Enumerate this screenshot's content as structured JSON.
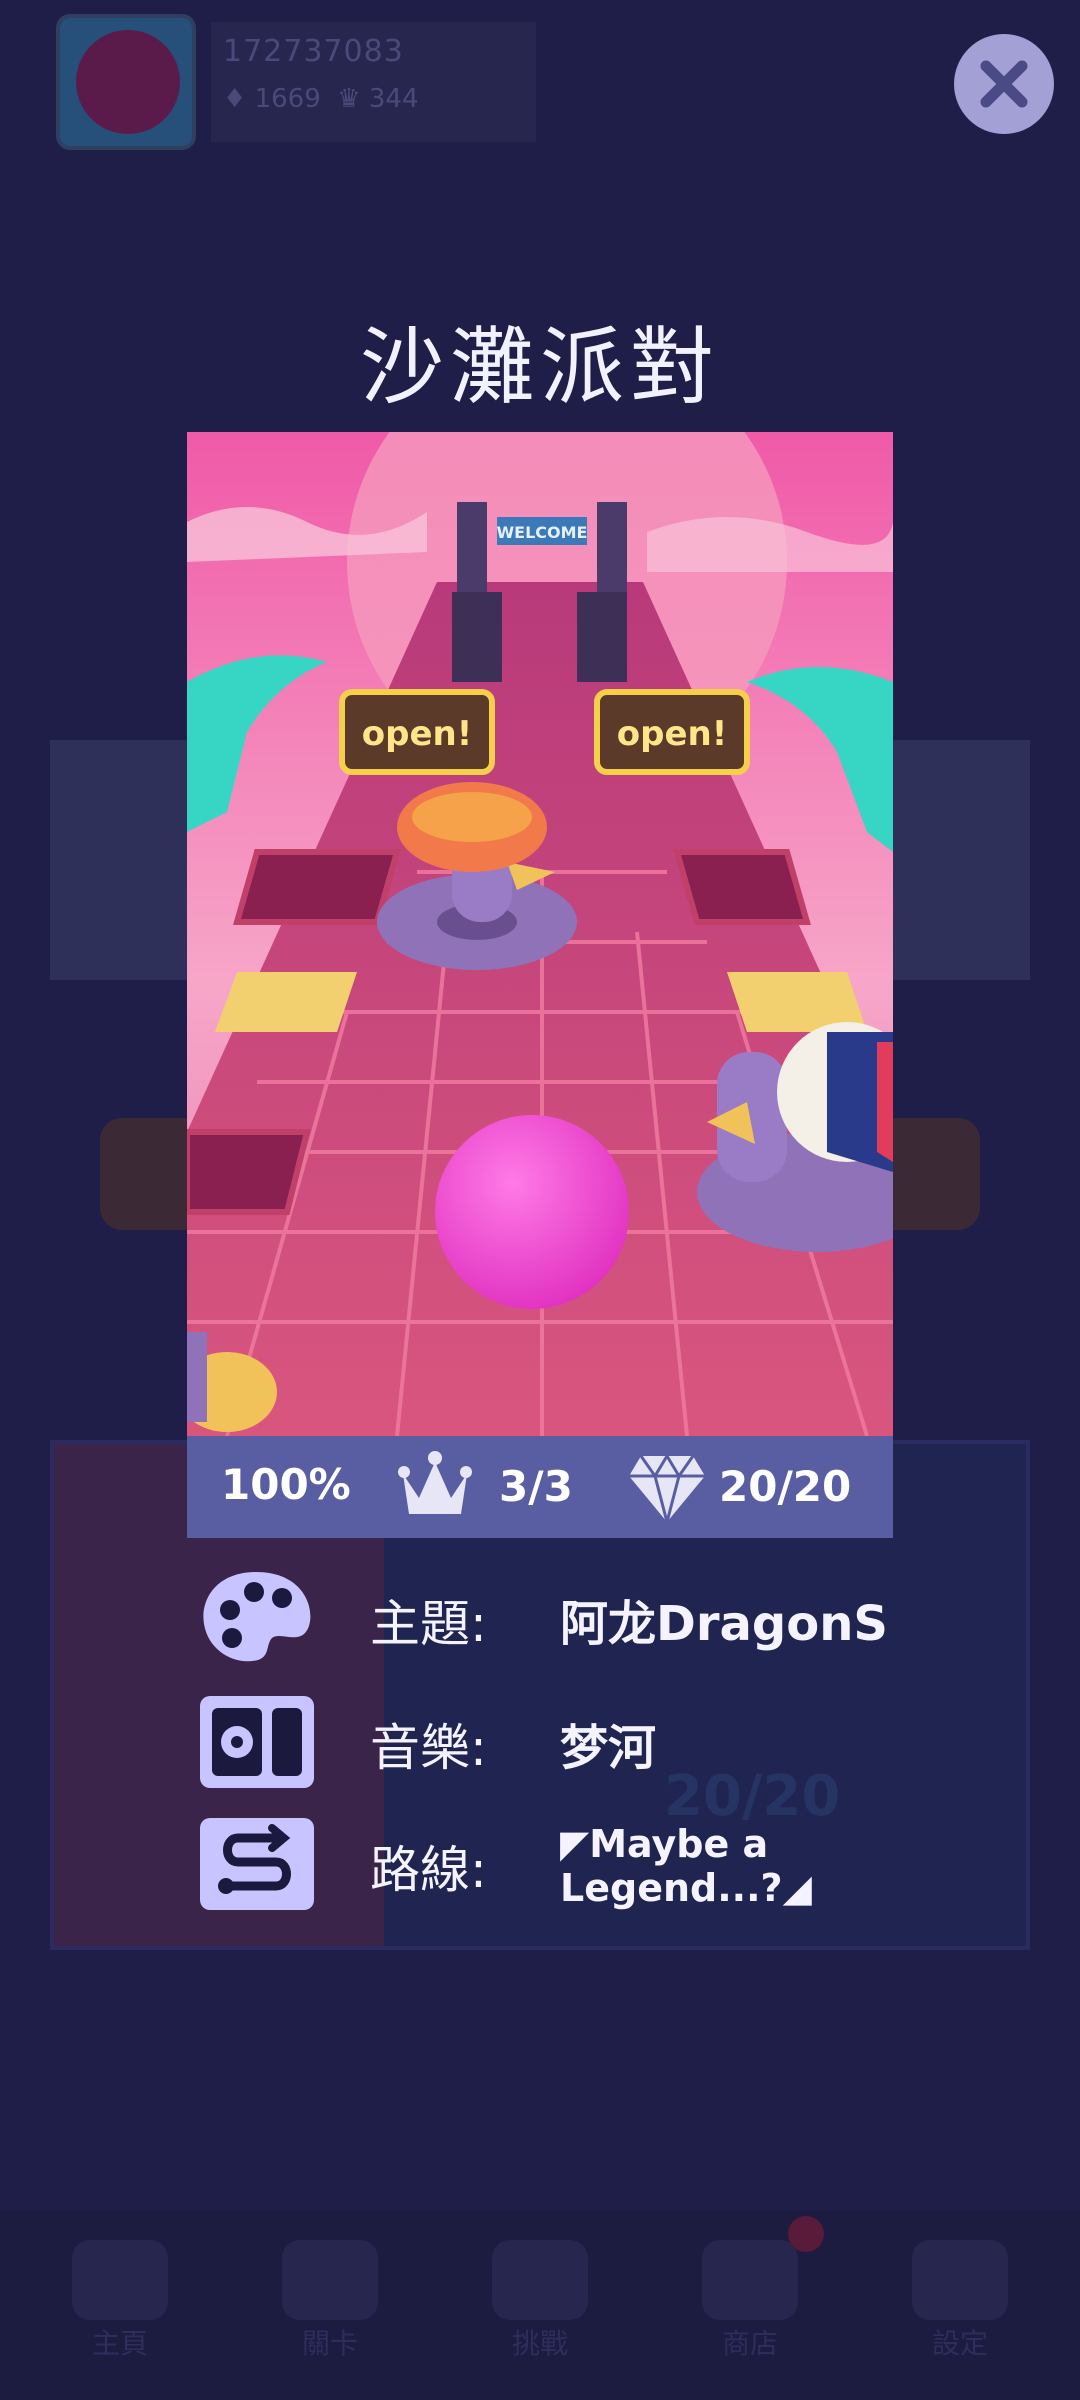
{
  "background": {
    "player_id": "172737083",
    "gems": "1669",
    "crowns": "344",
    "bg_card_crown_count": "20/20",
    "nav": [
      "主頁",
      "關卡",
      "挑戰",
      "商店",
      "設定"
    ]
  },
  "modal": {
    "title": "沙灘派對",
    "close_icon": "close-icon",
    "stats": {
      "progress": "100%",
      "crowns": "3/3",
      "gems": "20/20"
    },
    "info": [
      {
        "icon": "palette-icon",
        "label": "主題:",
        "value": "阿龙DragonS"
      },
      {
        "icon": "music-player-icon",
        "label": "音樂:",
        "value": "梦河"
      },
      {
        "icon": "route-icon",
        "label": "路線:",
        "value_line1": "◤Maybe a",
        "value_line2": "Legend...?◢"
      }
    ],
    "preview_sign_text": "WELCOME",
    "preview_open_text": "open!"
  },
  "colors": {
    "stat_bar": "#595ea3",
    "icon_bg": "#c8c4ff",
    "close_btn": "#a3a0d6",
    "ball": "#ff4fd8"
  }
}
